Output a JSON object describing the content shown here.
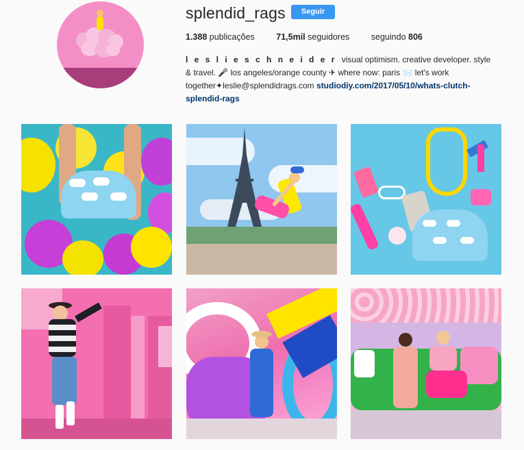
{
  "profile": {
    "username": "splendid_rags",
    "follow_label": "Seguir",
    "stats": {
      "posts_count": "1.388",
      "posts_label": "publicações",
      "followers_count": "71,5mil",
      "followers_label": "seguidores",
      "following_label": "seguindo",
      "following_count": "806"
    },
    "bio": {
      "name": "l e s l i e s c h n e i d e r",
      "line1": "visual optimism. creative developer. style & travel. 🎤 los angeles/orange county ✈ where now: paris 📨 let's work together✦leslie@splendidrags.com",
      "link": "studiodiy.com/2017/05/10/whats-clutch-splendid-rags"
    }
  },
  "posts": [
    {
      "alt_icon": "balloons-photo"
    },
    {
      "alt_icon": "eiffel-tower-photo"
    },
    {
      "alt_icon": "flatlay-photo"
    },
    {
      "alt_icon": "pink-wall-photo"
    },
    {
      "alt_icon": "mural-photo"
    },
    {
      "alt_icon": "flower-wall-photo"
    }
  ],
  "colors": {
    "accent": "#3897f0",
    "link": "#003569",
    "background": "#fafafa"
  }
}
